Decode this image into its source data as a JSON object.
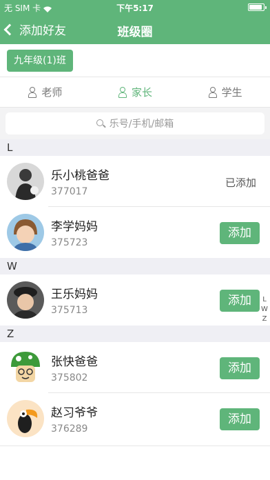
{
  "status_bar": {
    "carrier": "无 SIM 卡",
    "time": "下午5:17"
  },
  "nav": {
    "back_label": "添加好友",
    "title": "班级圈"
  },
  "class_selector": {
    "label": "九年级(1)班"
  },
  "tabs": [
    {
      "label": "老师",
      "active": false
    },
    {
      "label": "家长",
      "active": true
    },
    {
      "label": "学生",
      "active": false
    }
  ],
  "search": {
    "placeholder": "乐号/手机/邮箱"
  },
  "sections": [
    {
      "letter": "L",
      "contacts": [
        {
          "name": "乐小桃爸爸",
          "id": "377017",
          "status": "已添加"
        },
        {
          "name": "李学妈妈",
          "id": "375723",
          "button": "添加"
        }
      ]
    },
    {
      "letter": "W",
      "contacts": [
        {
          "name": "王乐妈妈",
          "id": "375713",
          "button": "添加"
        }
      ]
    },
    {
      "letter": "Z",
      "contacts": [
        {
          "name": "张快爸爸",
          "id": "375802",
          "button": "添加"
        },
        {
          "name": "赵习爷爷",
          "id": "376289",
          "button": "添加"
        }
      ]
    }
  ],
  "index_letters": [
    "L",
    "W",
    "Z"
  ],
  "colors": {
    "accent": "#5fb57a",
    "section_bg": "#efeff4"
  }
}
